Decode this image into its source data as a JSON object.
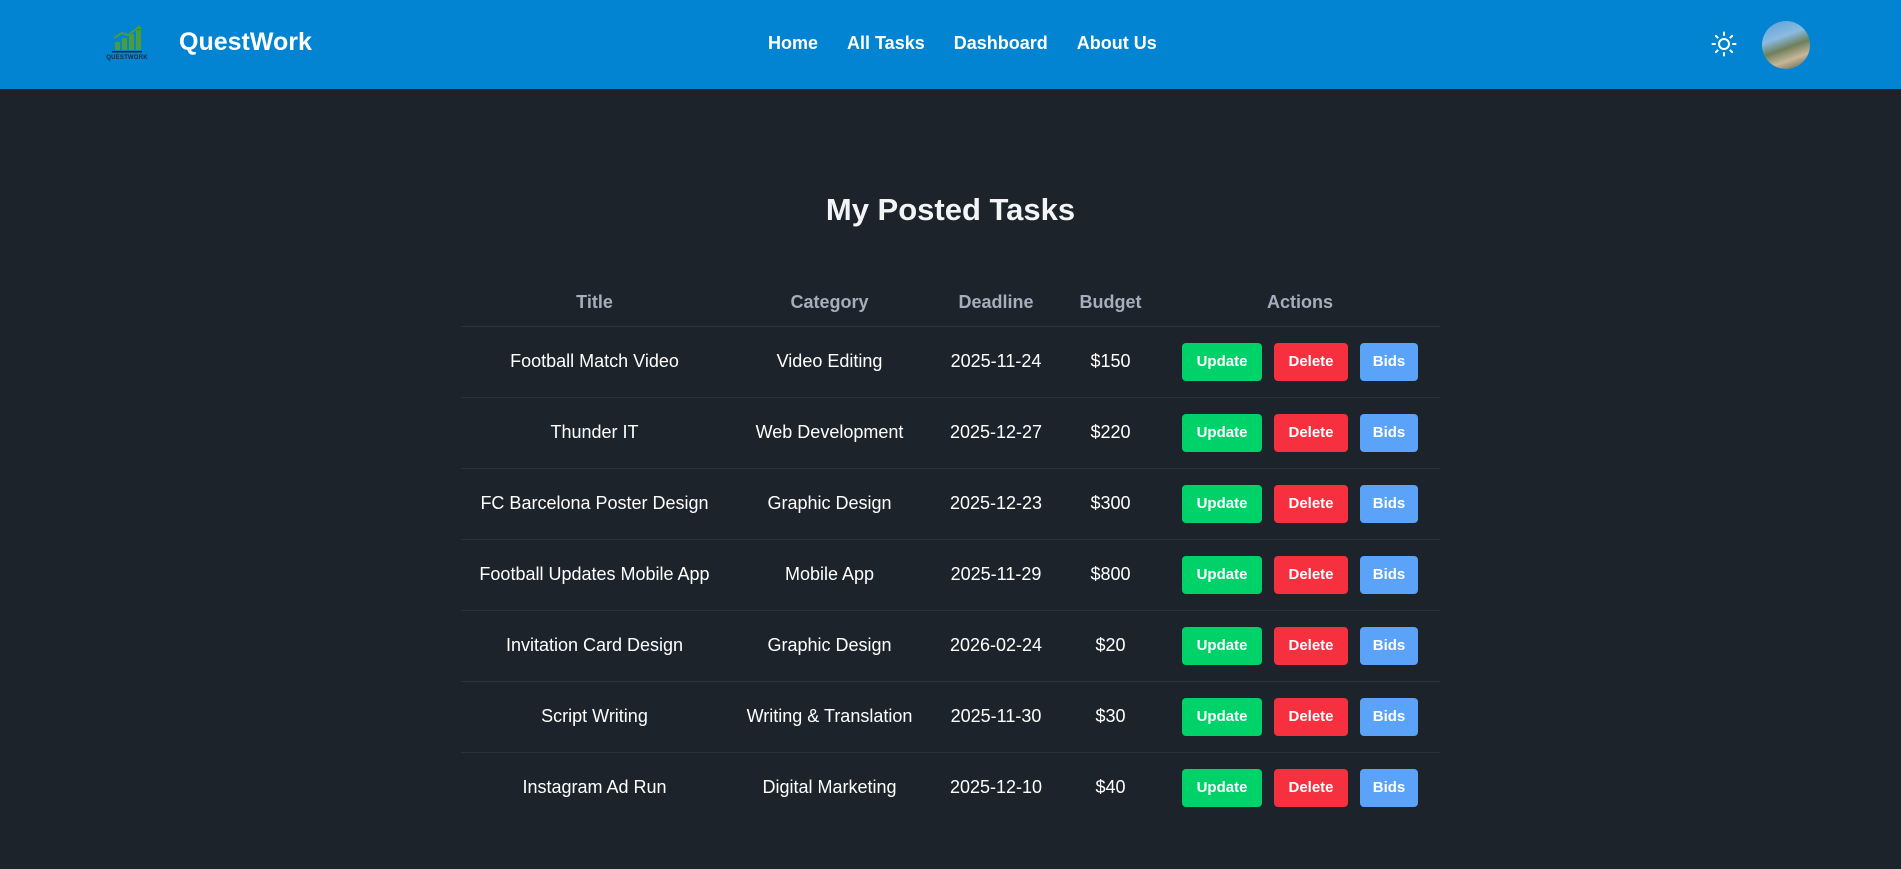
{
  "navbar": {
    "logo_text": "QUESTWORK",
    "brand_name": "QuestWork",
    "links": [
      "Home",
      "All Tasks",
      "Dashboard",
      "About Us"
    ],
    "theme_icon": "sun-icon",
    "colors": {
      "bar": "#0284d2"
    }
  },
  "main": {
    "title": "My Posted Tasks",
    "columns": [
      "Title",
      "Category",
      "Deadline",
      "Budget",
      "Actions"
    ],
    "buttons": {
      "update": "Update",
      "delete": "Delete",
      "bids": "Bids"
    },
    "rows": [
      {
        "title": "Football Match Video",
        "category": "Video Editing",
        "deadline": "2025-11-24",
        "budget": "$150"
      },
      {
        "title": "Thunder IT",
        "category": "Web Development",
        "deadline": "2025-12-27",
        "budget": "$220"
      },
      {
        "title": "FC Barcelona Poster Design",
        "category": "Graphic Design",
        "deadline": "2025-12-23",
        "budget": "$300"
      },
      {
        "title": "Football Updates Mobile App",
        "category": "Mobile App",
        "deadline": "2025-11-29",
        "budget": "$800"
      },
      {
        "title": "Invitation Card Design",
        "category": "Graphic Design",
        "deadline": "2026-02-24",
        "budget": "$20"
      },
      {
        "title": "Script Writing",
        "category": "Writing & Translation",
        "deadline": "2025-11-30",
        "budget": "$30"
      },
      {
        "title": "Instagram Ad Run",
        "category": "Digital Marketing",
        "deadline": "2025-12-10",
        "budget": "$40"
      }
    ],
    "colors": {
      "update": "#00d26a",
      "delete": "#f6303f",
      "bids": "#5aa3f8",
      "background": "#1d232a"
    }
  }
}
